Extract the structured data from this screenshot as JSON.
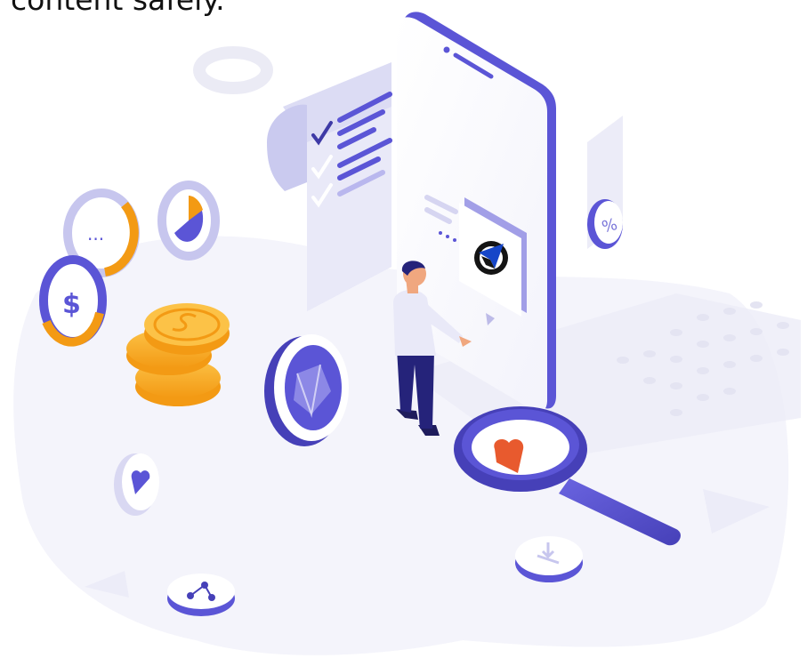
{
  "caption": "content safely.",
  "icons": {
    "percent": "%",
    "dollar": "$",
    "dots": "..."
  },
  "colors": {
    "primary": "#5b55d6",
    "primary_dark": "#4640b8",
    "lavender": "#e3e3f6",
    "soft_bg": "#f4f4fb",
    "orange": "#f39a14",
    "gold": "#fbb62d",
    "heart": "#e85a2e"
  }
}
